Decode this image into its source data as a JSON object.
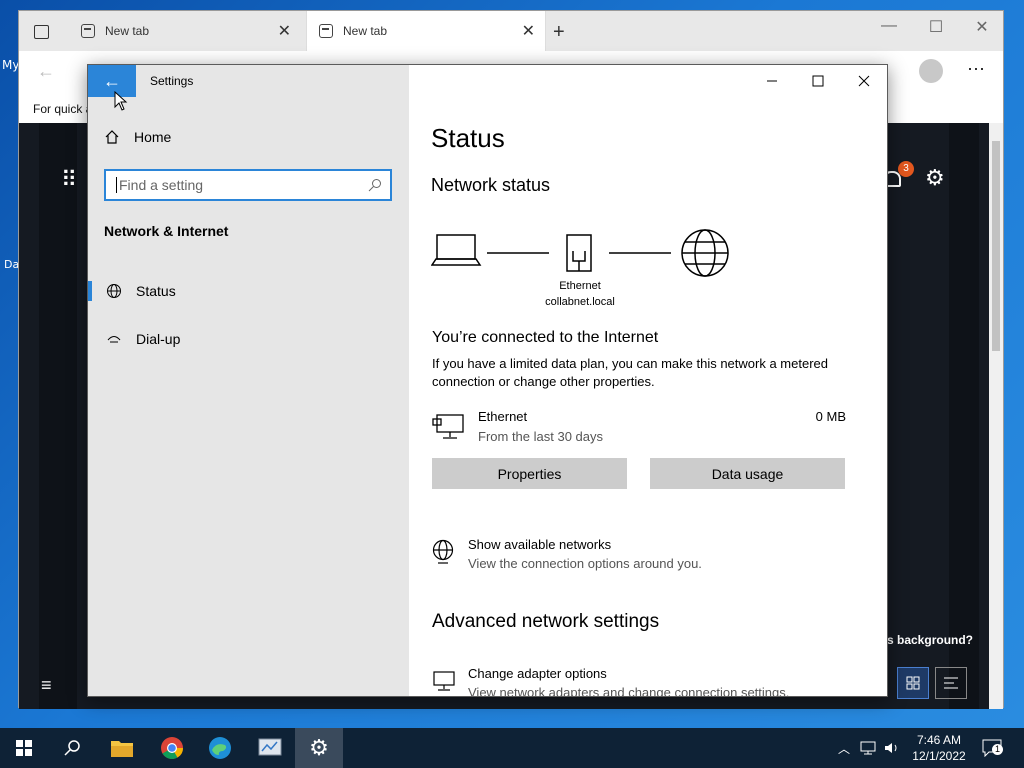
{
  "desktop": {
    "label_1": "My",
    "label_2": "Da"
  },
  "browser": {
    "tabs": [
      {
        "label": "New tab"
      },
      {
        "label": "New tab"
      }
    ],
    "favorites_text": "For quick a",
    "overlay_text": "s background?",
    "badge_count": "3"
  },
  "settings": {
    "window_title": "Settings",
    "home_label": "Home",
    "search_placeholder": "Find a setting",
    "section_title": "Network & Internet",
    "nav": [
      {
        "label": "Status"
      },
      {
        "label": "Dial-up"
      }
    ],
    "page_title": "Status",
    "network_status_heading": "Network status",
    "ethernet_label": "Ethernet",
    "domain_label": "collabnet.local",
    "connected_title": "You’re connected to the Internet",
    "connected_desc": "If you have a limited data plan, you can make this network a metered connection or change other properties.",
    "adapter": {
      "name": "Ethernet",
      "period": "From the last 30 days",
      "usage": "0 MB"
    },
    "properties_button": "Properties",
    "data_usage_button": "Data usage",
    "show_networks": {
      "title": "Show available networks",
      "desc": "View the connection options around you."
    },
    "advanced_heading": "Advanced network settings",
    "change_adapter": {
      "title": "Change adapter options",
      "desc": "View network adapters and change connection settings."
    }
  },
  "taskbar": {
    "time": "7:46 AM",
    "date": "12/1/2022",
    "notification_count": "1"
  }
}
